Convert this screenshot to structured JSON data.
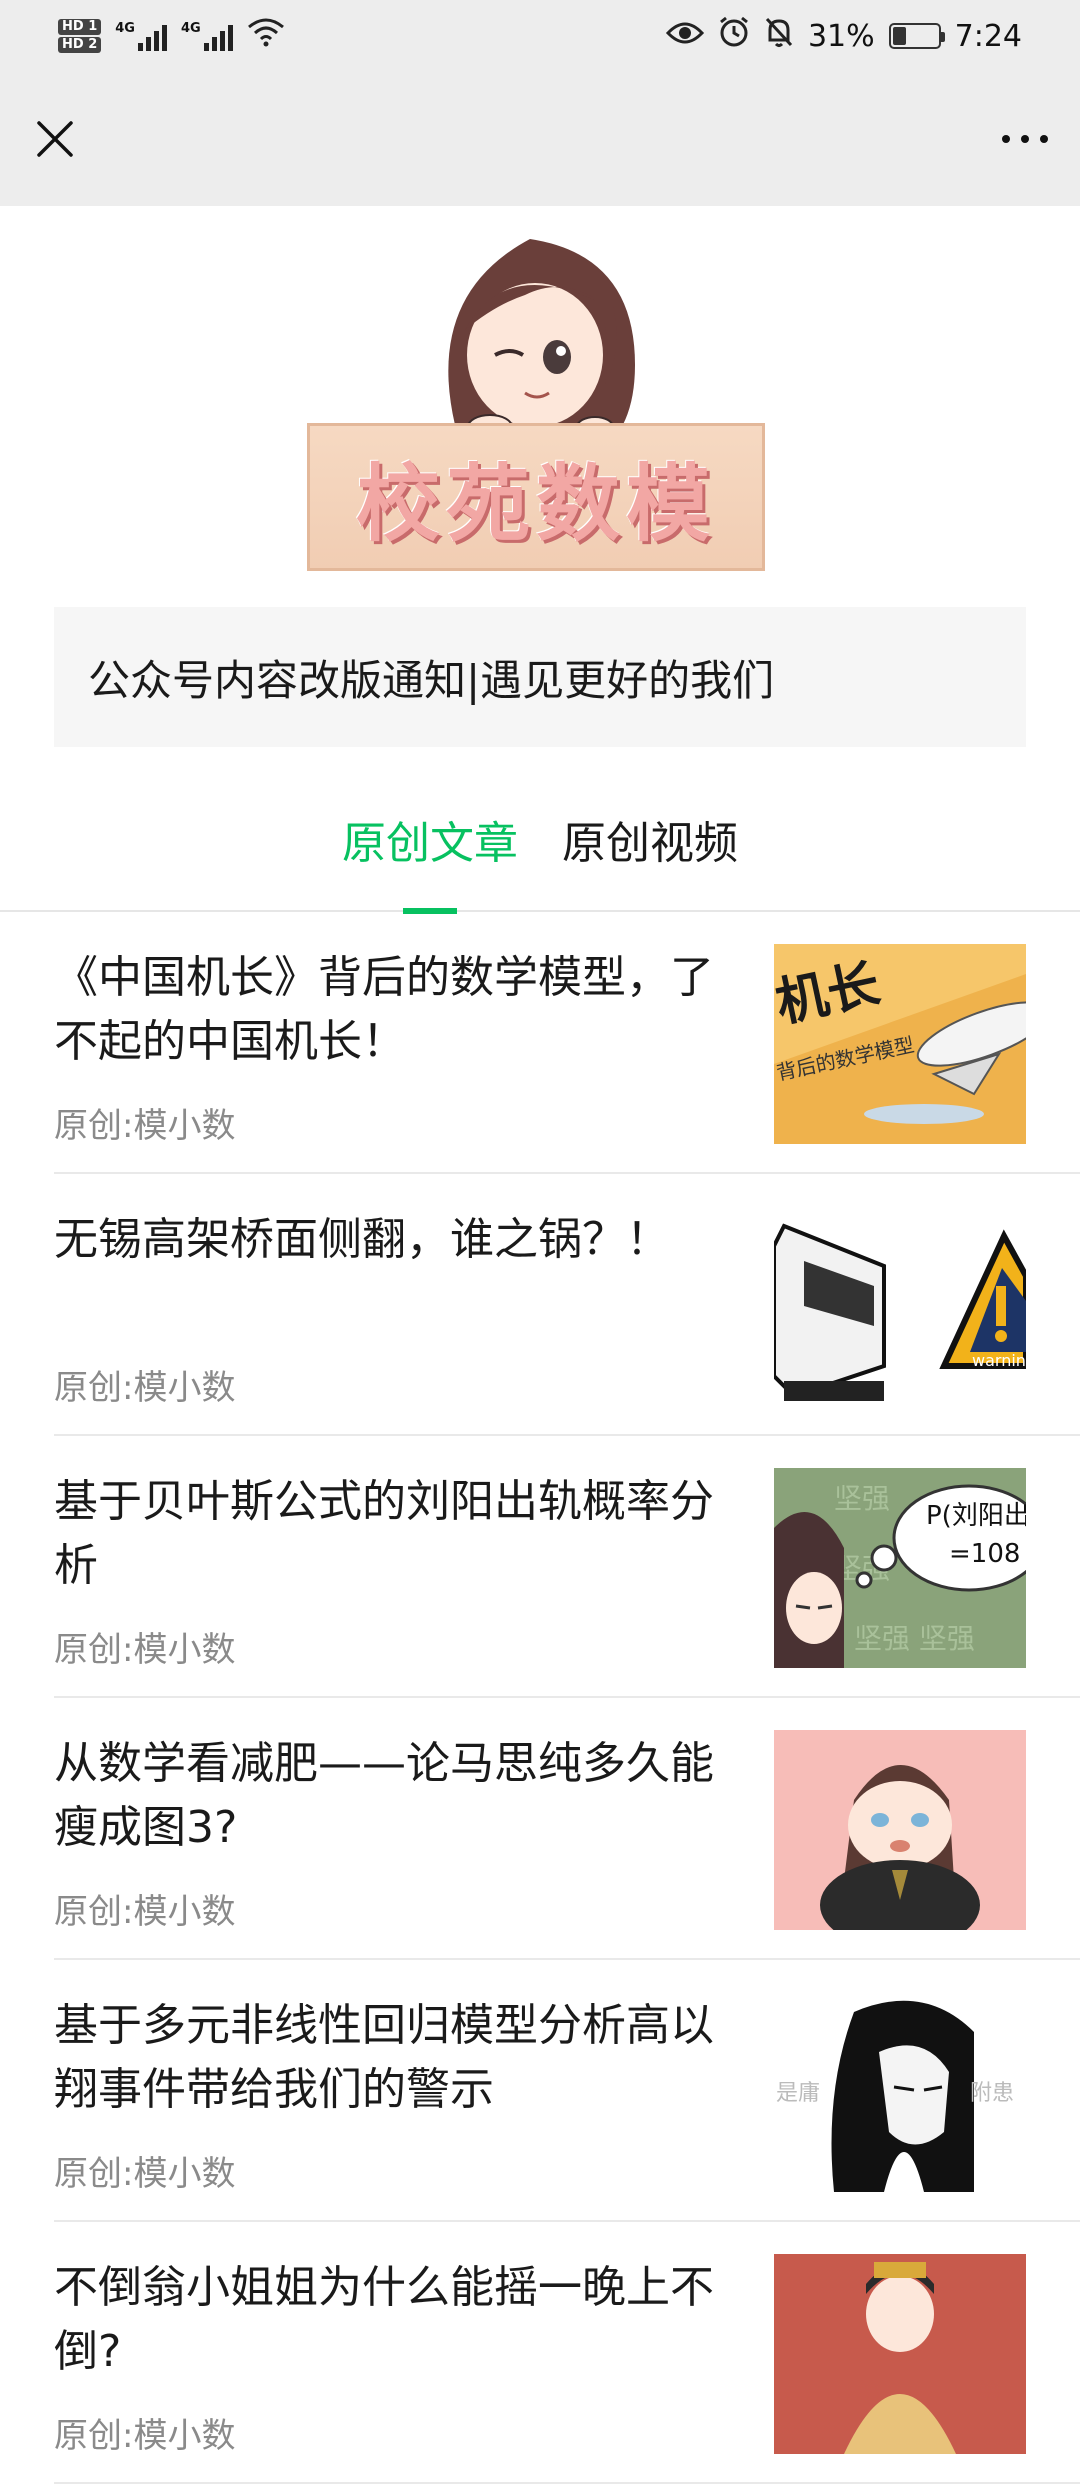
{
  "status_bar": {
    "hd1": "HD 1",
    "hd2": "HD 2",
    "net1": "4G",
    "net2": "4G",
    "battery_pct": "31%",
    "battery_level": 0.31,
    "time": "7:24"
  },
  "nav": {
    "close_icon": "close-icon",
    "more_icon": "more-icon"
  },
  "header": {
    "logo_text": "校苑数模"
  },
  "notice": {
    "text": "公众号内容改版通知|遇见更好的我们"
  },
  "tabs": [
    {
      "label": "原创文章",
      "active": true
    },
    {
      "label": "原创视频",
      "active": false
    }
  ],
  "articles": [
    {
      "title": "《中国机长》背后的数学模型，了不起的中国机长！",
      "meta": "原创:模小数",
      "thumb": {
        "bg": "#f0b24a",
        "caption": "机长",
        "sub": "背后的数学模型"
      }
    },
    {
      "title": "无锡高架桥面侧翻，谁之锅？！",
      "meta": "原创:模小数",
      "thumb": {
        "bg": "#ffffff",
        "caption": "warnin"
      }
    },
    {
      "title": "基于贝叶斯公式的刘阳出轨概率分析",
      "meta": "原创:模小数",
      "thumb": {
        "bg": "#8aa37a",
        "caption": "P(刘阳出",
        "sub": "=108"
      }
    },
    {
      "title": "从数学看减肥——论马思纯多久能瘦成图3?",
      "meta": "原创:模小数",
      "thumb": {
        "bg": "#f7bdb8"
      }
    },
    {
      "title": "基于多元非线性回归模型分析高以翔事件带给我们的警示",
      "meta": "原创:模小数",
      "thumb": {
        "bg": "#ffffff"
      }
    },
    {
      "title": "不倒翁小姐姐为什么能摇一晚上不倒?",
      "meta": "原创:模小数",
      "thumb": {
        "bg": "#c75a4c"
      }
    }
  ]
}
